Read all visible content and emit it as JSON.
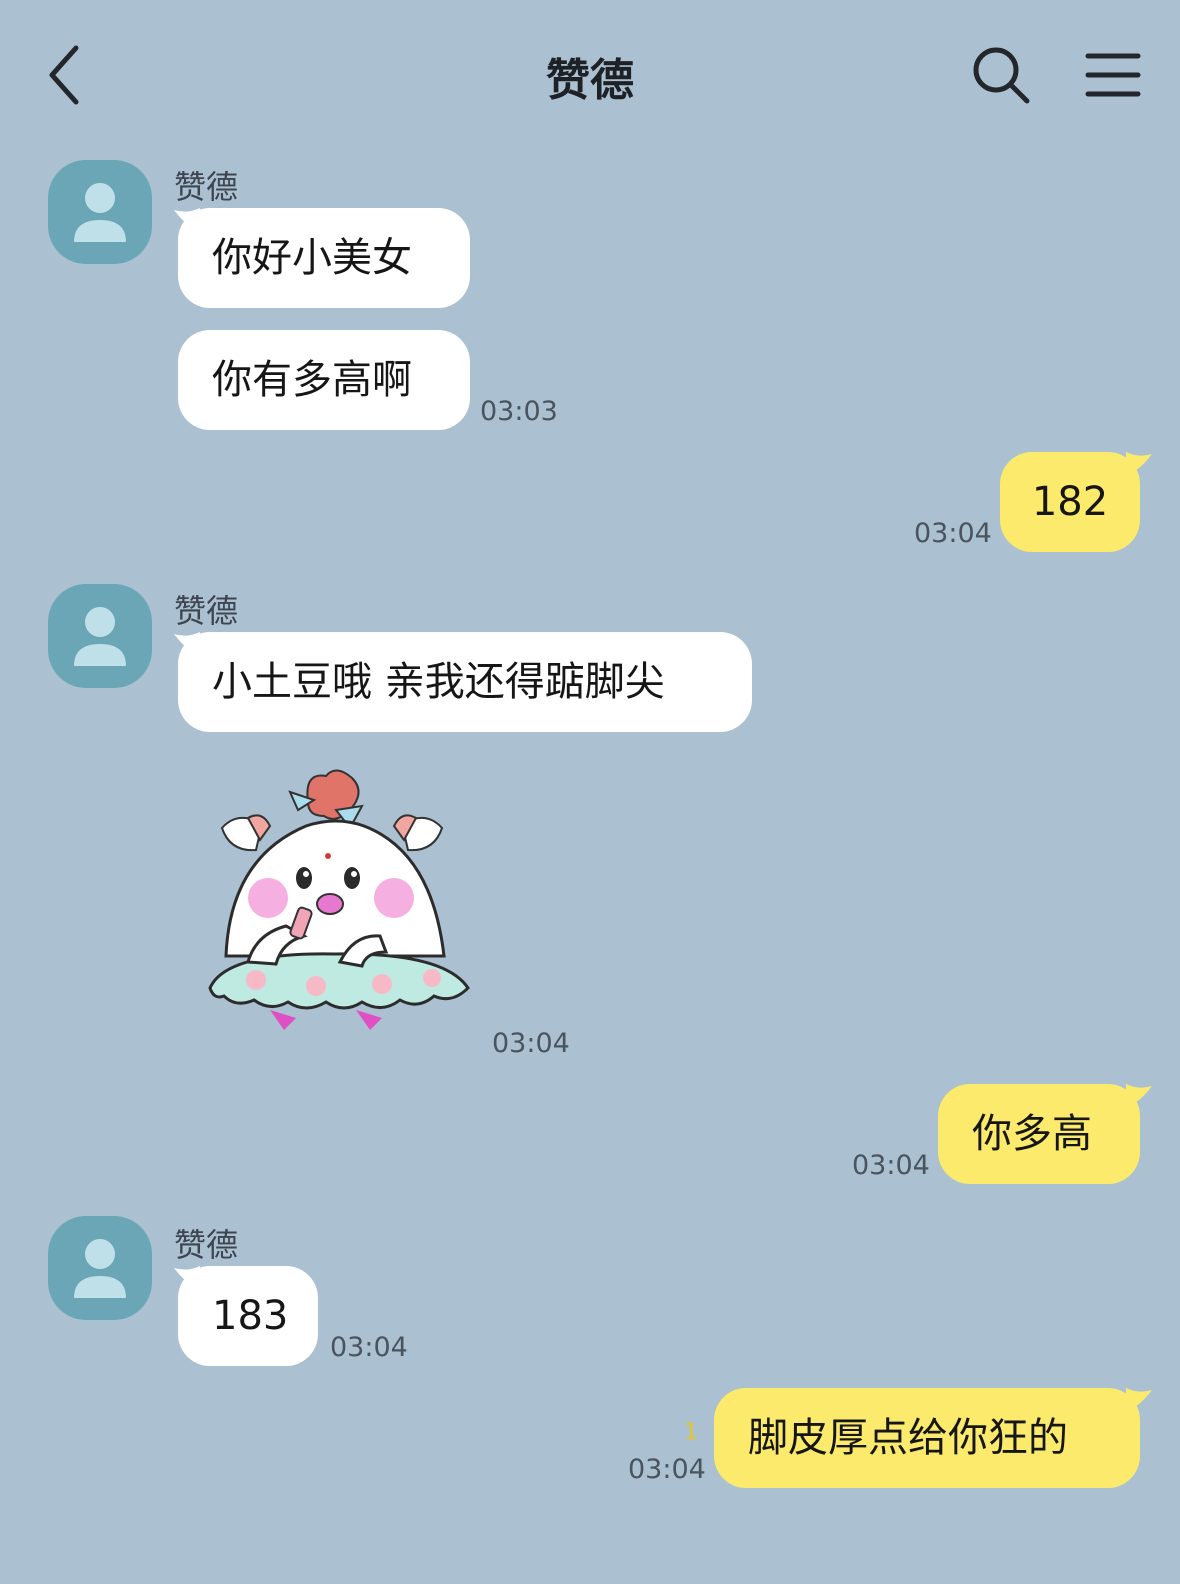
{
  "header": {
    "title": "赞德",
    "back_icon": "chevron-left-icon",
    "search_icon": "search-icon",
    "menu_icon": "menu-icon"
  },
  "colors": {
    "background": "#abc1d1",
    "incoming_bubble": "#ffffff",
    "outgoing_bubble": "#fbea6b",
    "avatar": "#6aa6b6",
    "unread_count": "#e7c623"
  },
  "messages": [
    {
      "sender": "赞德",
      "text": "你好小美女"
    },
    {
      "text": "你有多高啊",
      "time": "03:03"
    },
    {
      "text": "182",
      "time": "03:04"
    },
    {
      "sender": "赞德",
      "text": "小土豆哦 亲我还得踮脚尖"
    },
    {
      "sticker": "chick-lipstick-sticker",
      "time": "03:04"
    },
    {
      "text": "你多高",
      "time": "03:04"
    },
    {
      "sender": "赞德",
      "text": "183",
      "time": "03:04"
    },
    {
      "text": "脚皮厚点给你狂的",
      "time": "03:04",
      "unread": "1"
    }
  ]
}
